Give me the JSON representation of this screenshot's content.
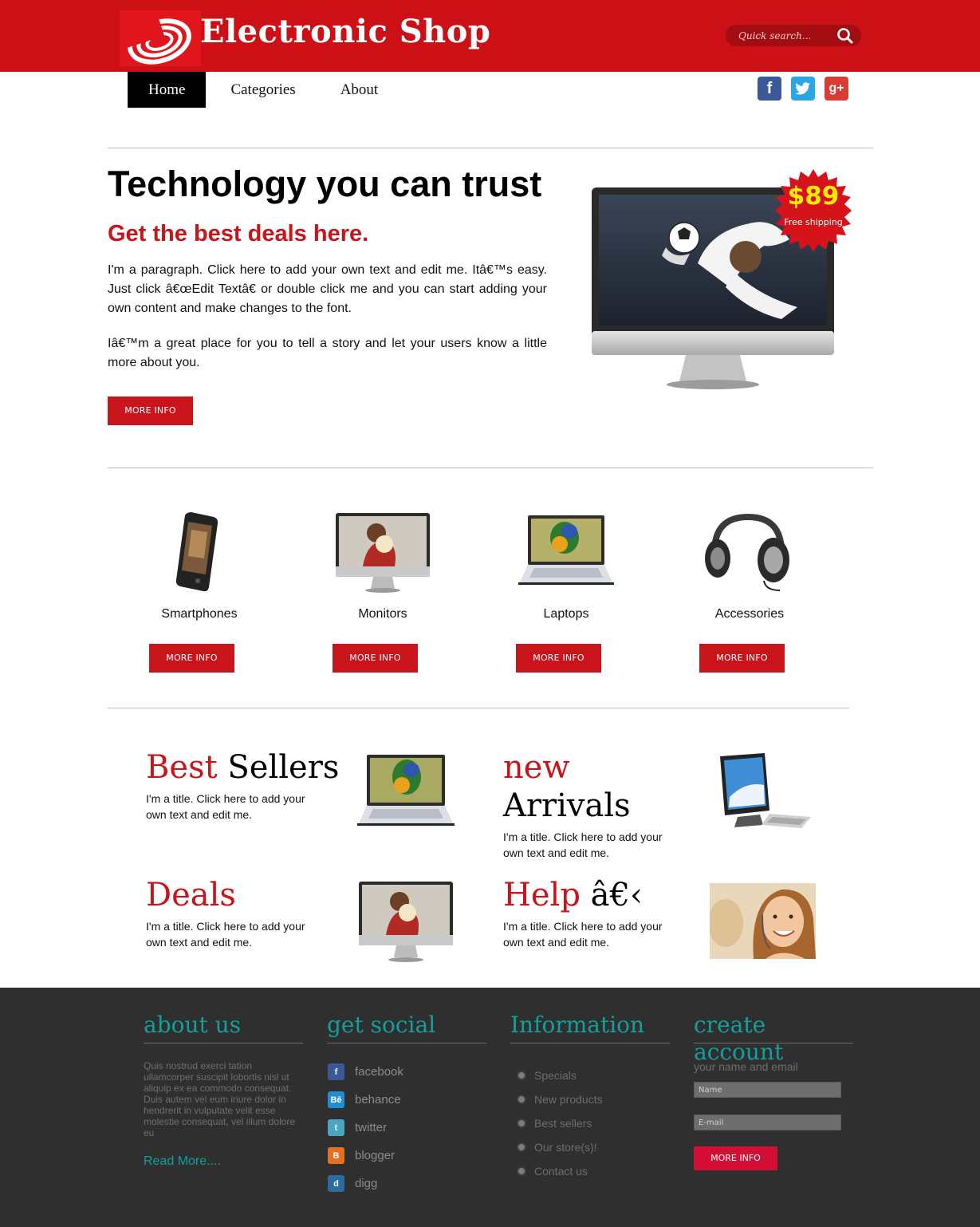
{
  "header": {
    "site_title": "Electronic Shop",
    "search_placeholder": "Quick search...",
    "brand_color": "#cc1016"
  },
  "nav": {
    "items": [
      {
        "label": "Home",
        "active": true
      },
      {
        "label": "Categories",
        "active": false
      },
      {
        "label": "About",
        "active": false
      }
    ],
    "social_icons": [
      "facebook-icon",
      "twitter-icon",
      "google-plus-icon"
    ]
  },
  "hero": {
    "title": "Technology you can trust",
    "subtitle": "Get the best deals here.",
    "paragraph_1": "I'm a paragraph. Click here to add your own text and edit me. Itâ€™s easy. Just click â€œEdit Textâ€ or double click me and you can start adding your own content and make changes to the font.",
    "paragraph_2": "Iâ€™m a great place for you to tell a story and let your users know a little more about you.",
    "button_label": "MORE INFO",
    "badge_price": "$89",
    "badge_text": "Free shipping"
  },
  "categories": [
    {
      "name": "Smartphones",
      "button": "MORE INFO"
    },
    {
      "name": "Monitors",
      "button": "MORE INFO"
    },
    {
      "name": "Laptops",
      "button": "MORE INFO"
    },
    {
      "name": "Accessories",
      "button": "MORE INFO"
    }
  ],
  "features": {
    "best_sellers": {
      "title_a": "Best",
      "title_b": "Sellers",
      "text": "I'm a title. Click here to add your own text and edit me."
    },
    "new_arrivals": {
      "title_a": "new",
      "title_b": "Arrivals",
      "text": "I'm a title. Click here to add your own text and edit me."
    },
    "deals": {
      "title_a": "Deals",
      "text": "I'm a title. Click here to add your own text and edit me."
    },
    "help": {
      "title_a": "Help",
      "title_b": "â€‹",
      "text": "I'm a title. Click here to add your own text and edit me."
    }
  },
  "footer": {
    "about": {
      "heading": "about us",
      "text": "Quis nostrud exerci tation ullamcorper suscipit lobortis nisl ut aliquip ex ea commodo consequat. Duis autem vel eum iriure dolor in hendrerit in vulputate velit esse molestie consequat, vel illum dolore eu",
      "read_more": "Read More...."
    },
    "social": {
      "heading": "get social",
      "items": [
        {
          "label": "facebook",
          "icon": "facebook-icon",
          "color": "#3b5999"
        },
        {
          "label": "behance",
          "icon": "behance-icon",
          "color": "#1f8ed2"
        },
        {
          "label": "twitter",
          "icon": "twitter-icon",
          "color": "#49a6c2"
        },
        {
          "label": "blogger",
          "icon": "blogger-icon",
          "color": "#e4711f"
        },
        {
          "label": "digg",
          "icon": "digg-icon",
          "color": "#2c6aa0"
        }
      ]
    },
    "information": {
      "heading": "Information",
      "items": [
        "Specials",
        "New products",
        "Best sellers",
        "Our store(s)!",
        "Contact us"
      ]
    },
    "create_account": {
      "heading_1": "create",
      "heading_2": "account",
      "subtitle": "your name and email",
      "name_placeholder": "Name",
      "email_placeholder": "E-mail",
      "button": "MORE INFO"
    },
    "accent_color": "#139f9c"
  }
}
